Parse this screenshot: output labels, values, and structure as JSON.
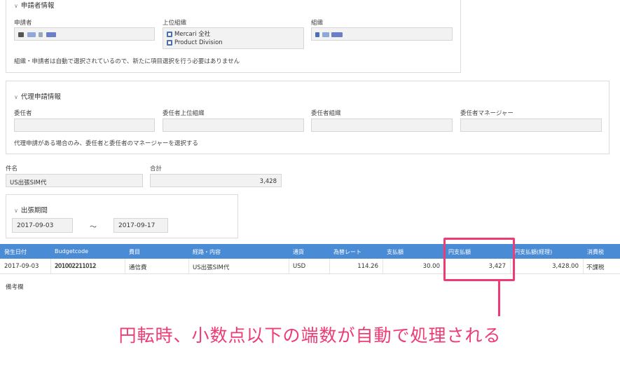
{
  "applicant_section": {
    "title": "申請者情報",
    "applicant_label": "申請者",
    "parent_org_label": "上位組織",
    "parent_org_items": [
      "Mercari 全社",
      "Product Division"
    ],
    "org_label": "組織",
    "note": "組織・申請者は自動で選択されているので、新たに項目選択を行う必要はありません"
  },
  "proxy_section": {
    "title": "代理申請情報",
    "delegator_label": "委任者",
    "delegator_parent_org_label": "委任者上位組織",
    "delegator_org_label": "委任者組織",
    "delegator_manager_label": "委任者マネージャー",
    "note": "代理申請がある場合のみ、委任者と委任者のマネージャーを選択する"
  },
  "subject": {
    "label": "件名",
    "value": "US出張SIM代"
  },
  "total": {
    "label": "合計",
    "value": "3,428"
  },
  "trip_period": {
    "title": "出張期間",
    "start": "2017-09-03",
    "separator": "〜",
    "end": "2017-09-17"
  },
  "table": {
    "headers": [
      "発生日付",
      "Budgetcode",
      "費目",
      "経路・内容",
      "通貨",
      "為替レート",
      "支払額",
      "円支払額",
      "円支払額(経理)",
      "消費税"
    ],
    "rows": [
      {
        "date": "2017-09-03",
        "budgetcode": "201002211012",
        "category": "通信費",
        "route": "US出張SIM代",
        "currency": "USD",
        "rate": "114.26",
        "amount": "30.00",
        "yen": "3,427",
        "yen_accounting": "3,428.00",
        "tax": "不課税"
      }
    ]
  },
  "remarks_label": "備考欄",
  "annotation": "円転時、小数点以下の端数が自動で処理される",
  "colors": {
    "header_blue": "#4a8bd5",
    "accent_pink": "#ee3b74"
  }
}
